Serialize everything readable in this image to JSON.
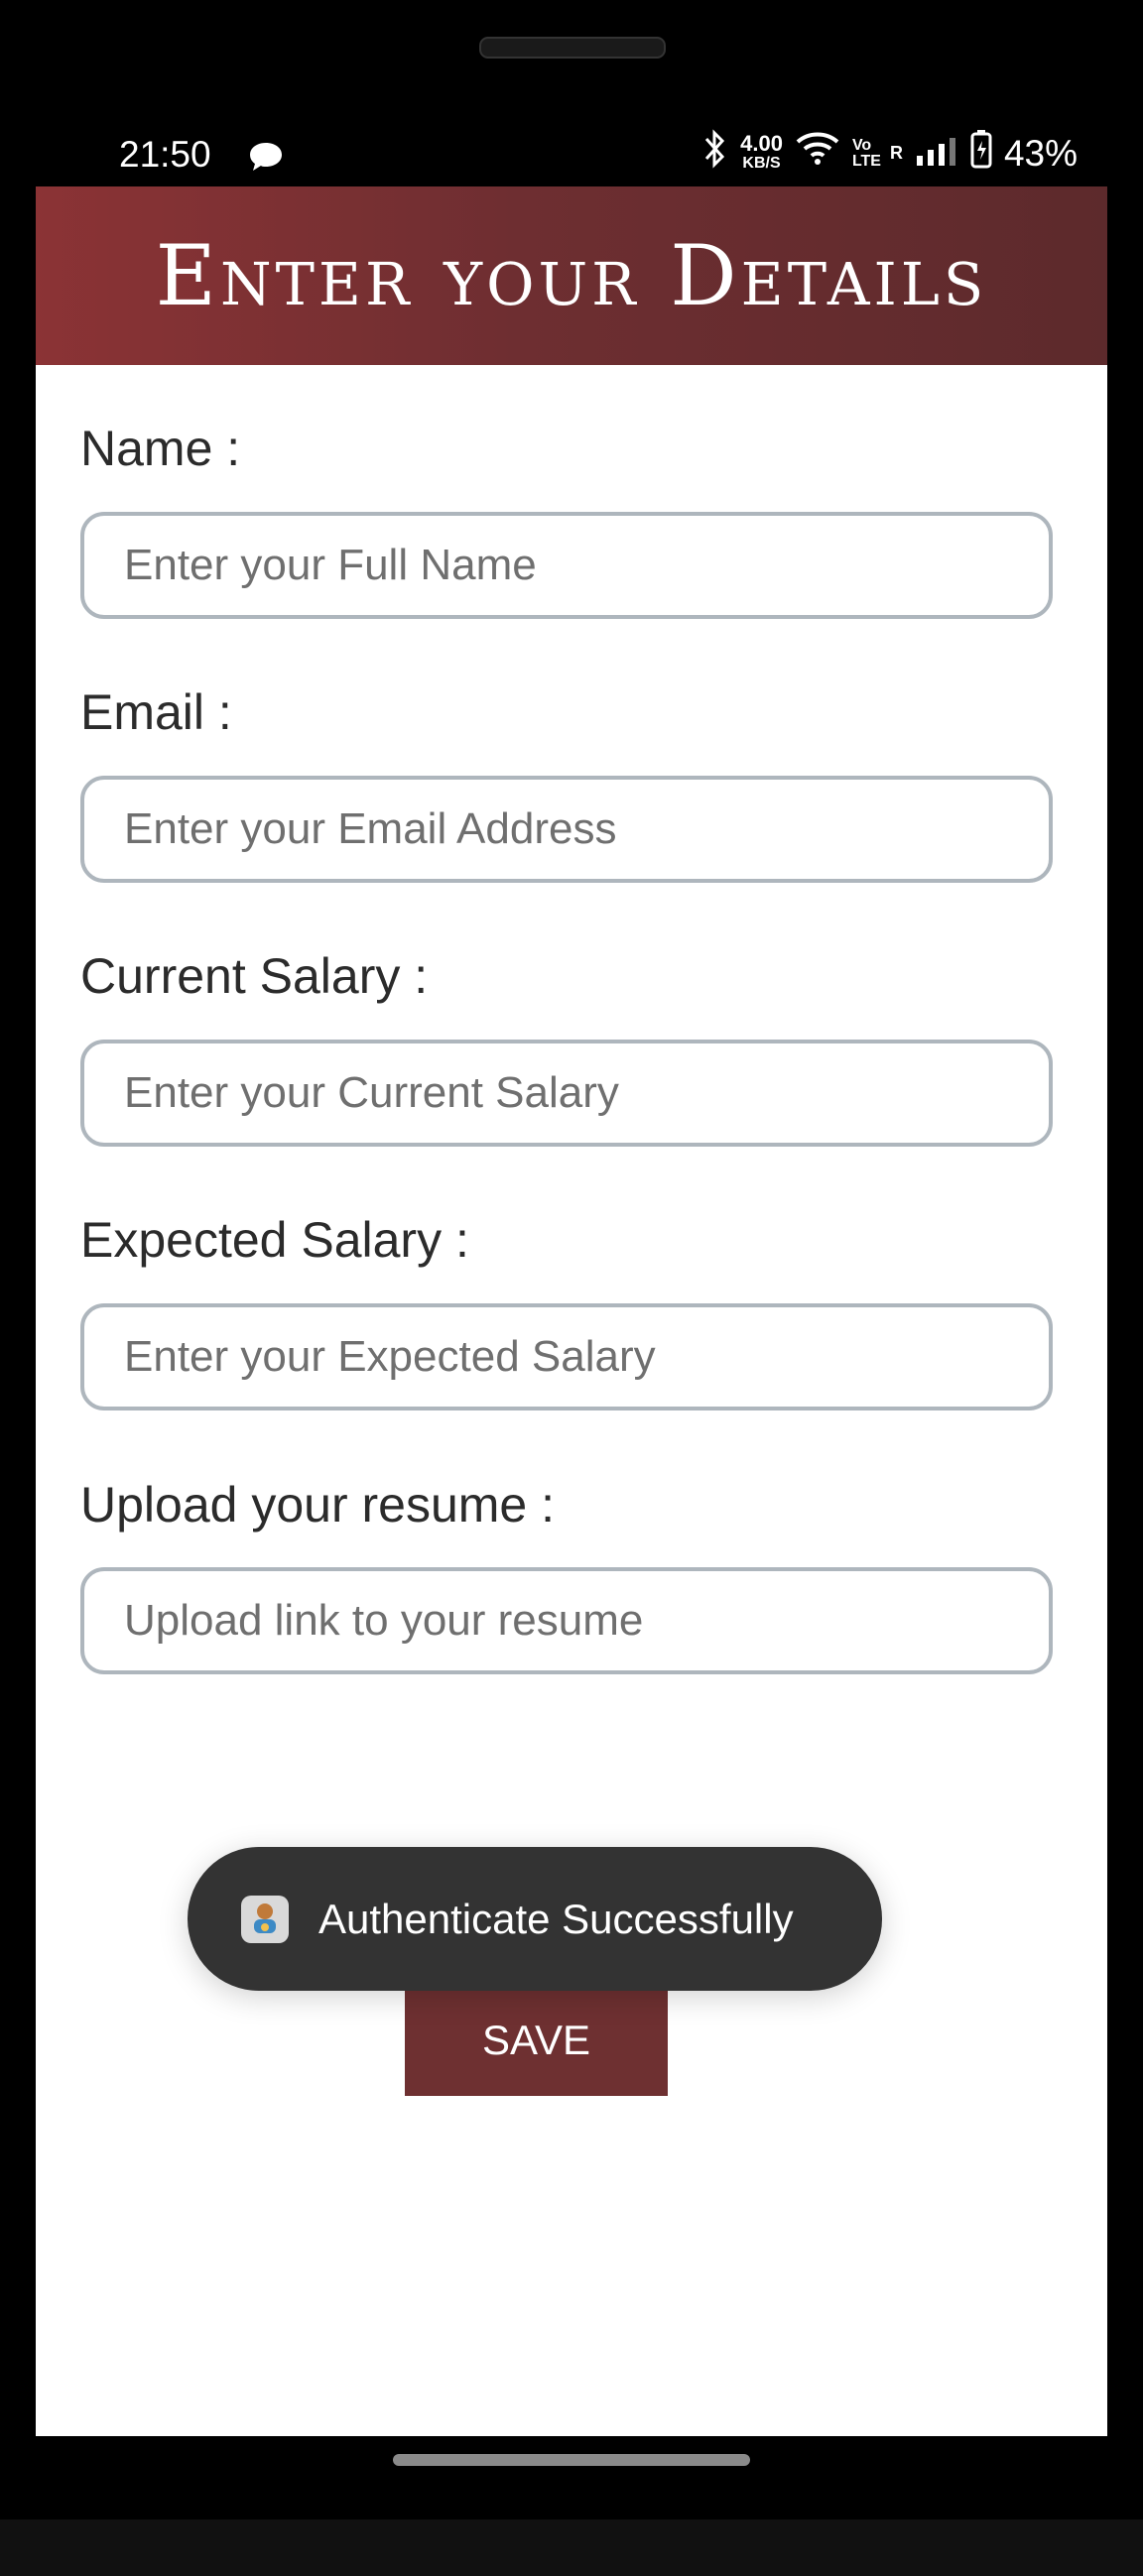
{
  "status_bar": {
    "time": "21:50",
    "speed_value": "4.00",
    "speed_unit": "KB/S",
    "volte": "Vo LTE",
    "roaming": "R",
    "battery_percent": "43%",
    "icons": [
      "chat-icon",
      "bluetooth-icon",
      "wifi-icon",
      "signal-icon",
      "battery-icon"
    ]
  },
  "header": {
    "title": "Enter your Details"
  },
  "form": {
    "fields": [
      {
        "label": "Name :",
        "placeholder": "Enter your Full Name",
        "value": ""
      },
      {
        "label": "Email :",
        "placeholder": "Enter your Email Address",
        "value": ""
      },
      {
        "label": "Current Salary :",
        "placeholder": "Enter your Current Salary",
        "value": ""
      },
      {
        "label": "Expected Salary :",
        "placeholder": "Enter your Expected Salary",
        "value": ""
      },
      {
        "label": "Upload your resume :",
        "placeholder": "Upload link to your resume",
        "value": ""
      }
    ],
    "save_label": "SAVE"
  },
  "toast": {
    "message": "Authenticate Successfully",
    "icon": "app-icon"
  },
  "colors": {
    "header_start": "#8b3335",
    "header_end": "#5d2a2c",
    "button": "#6e3031",
    "input_border": "#aeb6bd",
    "toast_bg": "#333333"
  }
}
